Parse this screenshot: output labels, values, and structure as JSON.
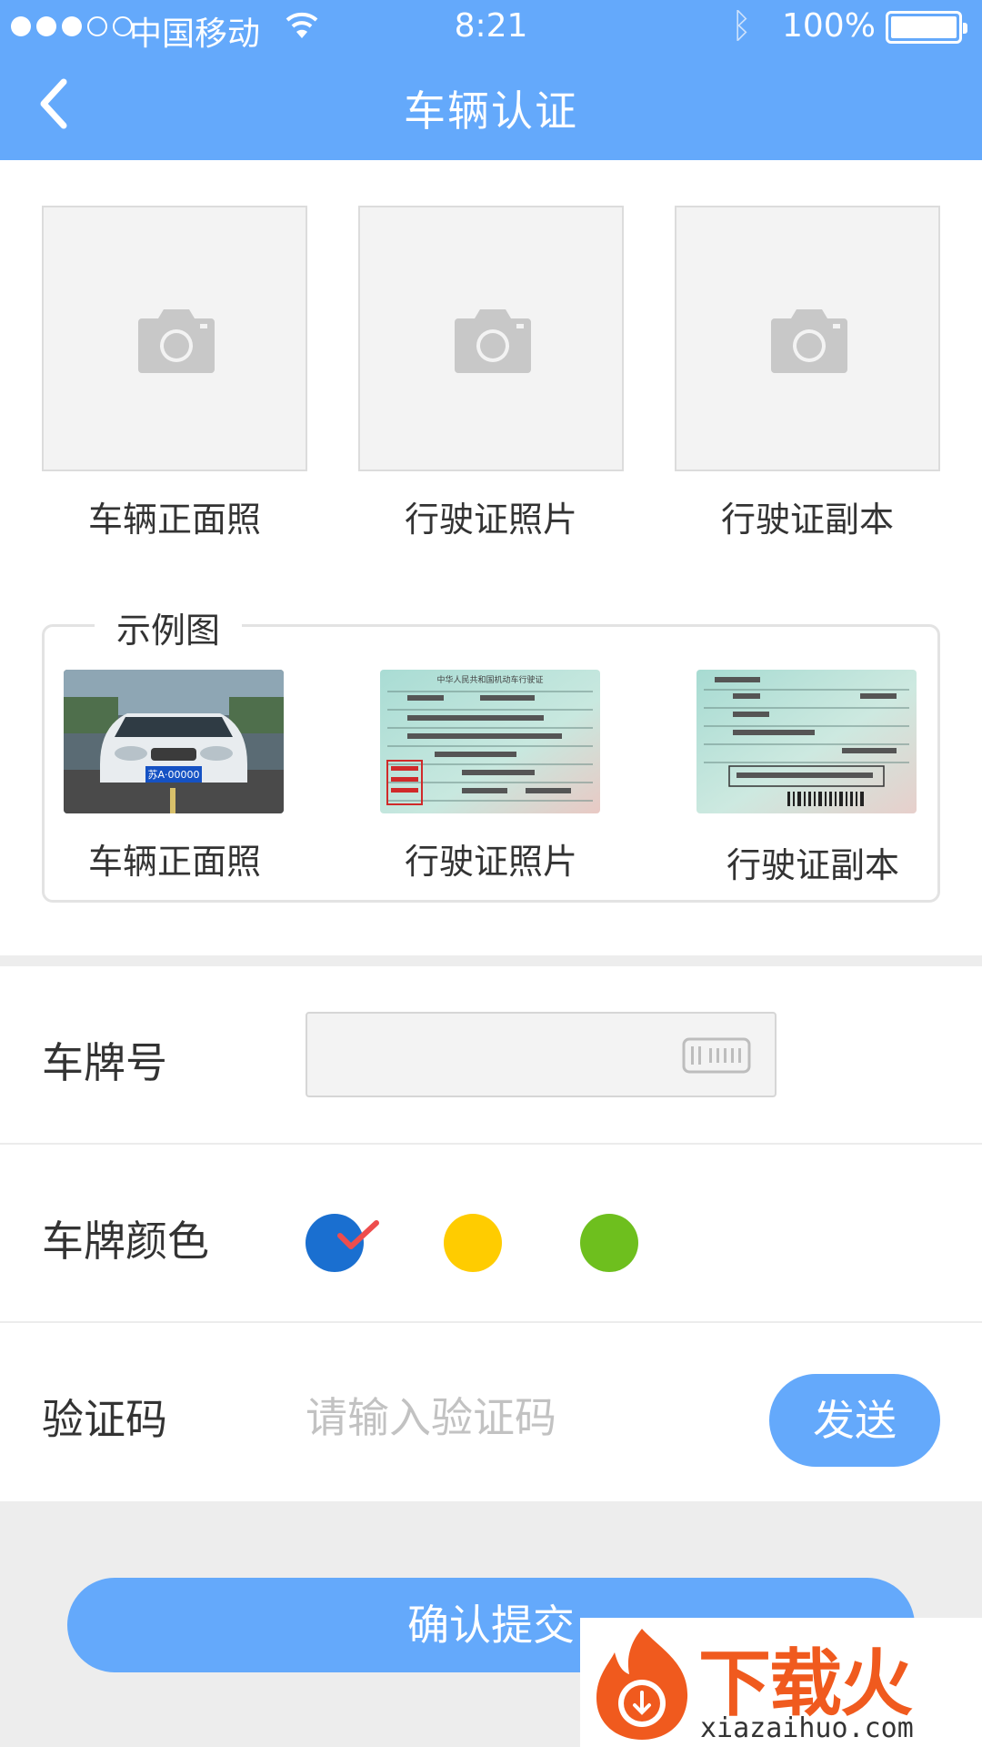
{
  "status_bar": {
    "carrier": "中国移动",
    "time": "8:21",
    "battery": "100%"
  },
  "header": {
    "title": "车辆认证"
  },
  "uploads": [
    {
      "label": "车辆正面照"
    },
    {
      "label": "行驶证照片"
    },
    {
      "label": "行驶证副本"
    }
  ],
  "examples": {
    "title": "示例图",
    "items": [
      {
        "label": "车辆正面照",
        "plate_text": "苏A·00000"
      },
      {
        "label": "行驶证照片",
        "doc_title": "中华人民共和国机动车行驶证"
      },
      {
        "label": "行驶证副本"
      }
    ]
  },
  "form": {
    "plate_label": "车牌号",
    "color_label": "车牌颜色",
    "colors": [
      {
        "name": "blue",
        "hex": "#1a6fd0",
        "selected": true
      },
      {
        "name": "yellow",
        "hex": "#ffcc00",
        "selected": false
      },
      {
        "name": "green",
        "hex": "#6ebf1e",
        "selected": false
      }
    ],
    "code_label": "验证码",
    "code_placeholder": "请输入验证码",
    "send_label": "发送"
  },
  "submit_label": "确认提交",
  "watermark": {
    "brand": "下载火",
    "url": "xiazaihuo.com"
  },
  "colors": {
    "accent": "#64a9fb",
    "brand_orange": "#f05a1e"
  }
}
